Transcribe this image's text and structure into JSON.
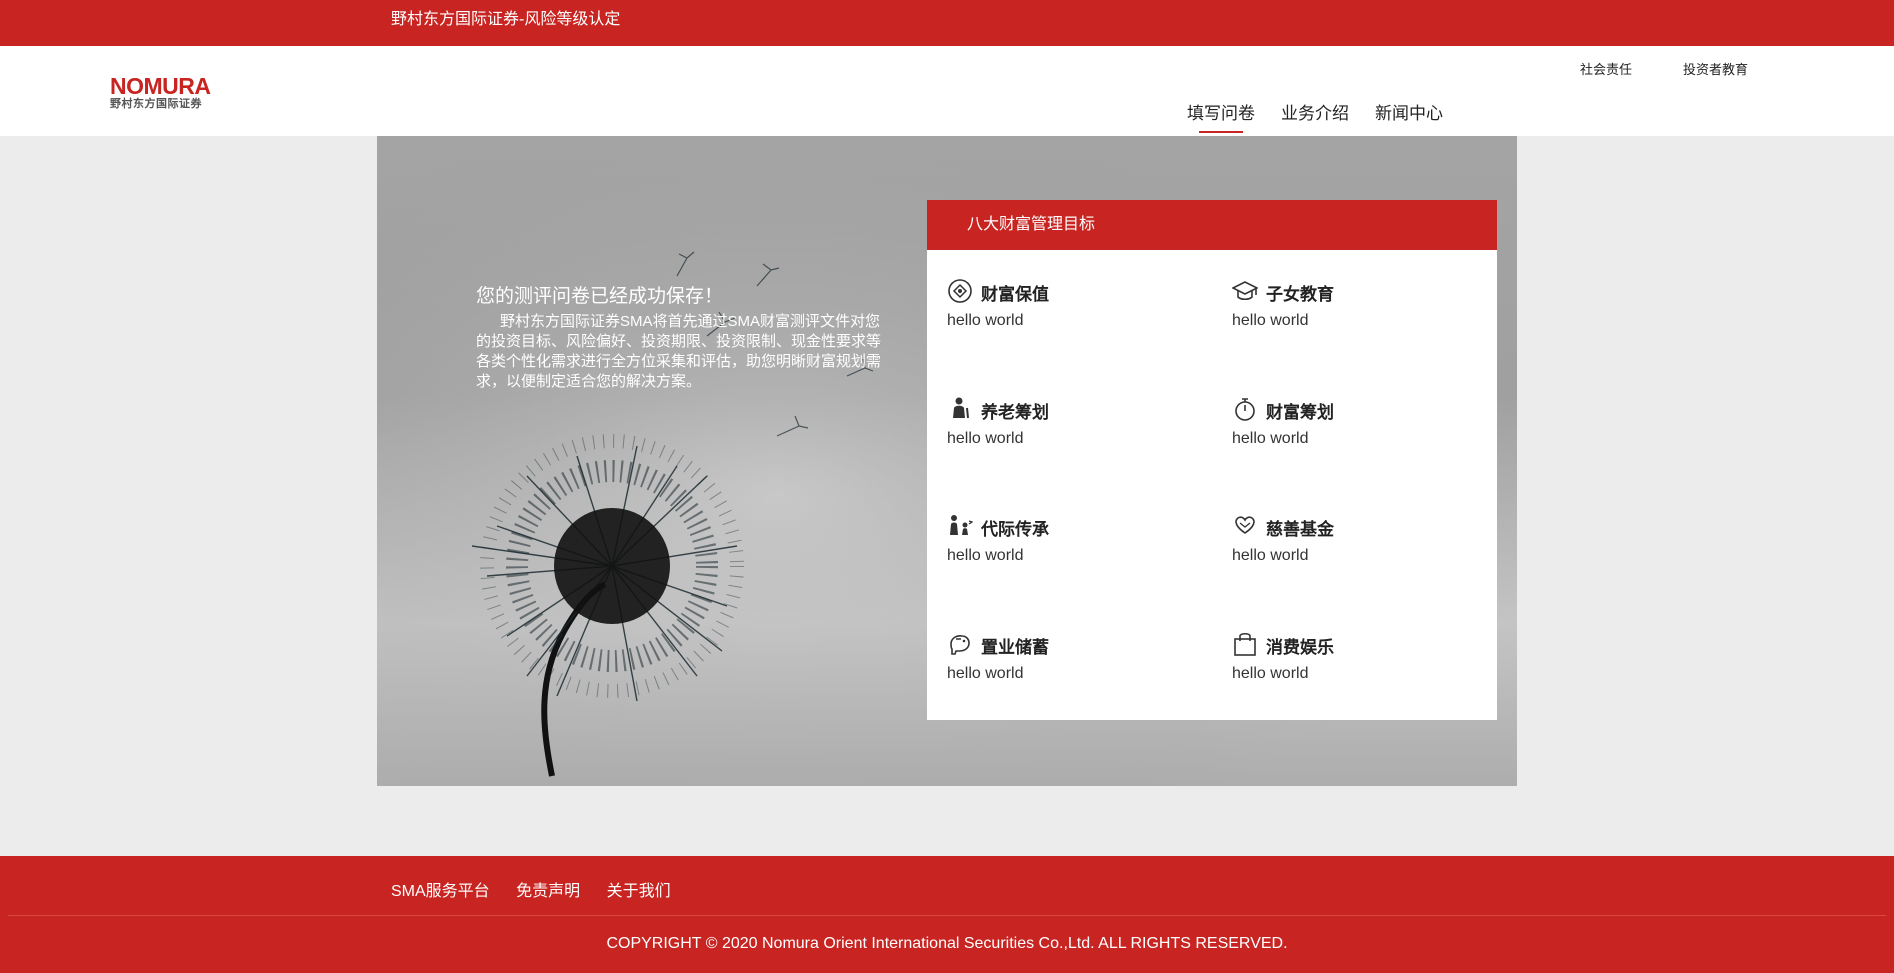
{
  "topbar": {
    "title": "野村东方国际证券-风险等级认定"
  },
  "header": {
    "logo_en": "NOMURA",
    "logo_cn": "野村东方国际证券",
    "util_links": [
      "社会责任",
      "投资者教育"
    ],
    "nav": [
      {
        "label": "填写问卷",
        "active": true
      },
      {
        "label": "业务介绍",
        "active": false
      },
      {
        "label": "新闻中心",
        "active": false
      }
    ]
  },
  "hero": {
    "heading": "您的测评问卷已经成功保存！",
    "body": "野村东方国际证券SMA将首先通过SMA财富测评文件对您的投资目标、风险偏好、投资期限、投资限制、现金性要求等各类个性化需求进行全方位采集和评估，助您明晰财富规划需求，以便制定适合您的解决方案。"
  },
  "card": {
    "title": "八大财富管理目标",
    "goals": [
      {
        "title": "财富保值",
        "desc": "hello world",
        "icon": "coin-target-icon"
      },
      {
        "title": "子女教育",
        "desc": "hello world",
        "icon": "graduation-cap-icon"
      },
      {
        "title": "养老筹划",
        "desc": "hello world",
        "icon": "elderly-person-icon"
      },
      {
        "title": "财富筹划",
        "desc": "hello world",
        "icon": "stopwatch-icon"
      },
      {
        "title": "代际传承",
        "desc": "hello world",
        "icon": "family-icon"
      },
      {
        "title": "慈善基金",
        "desc": "hello world",
        "icon": "heart-hands-icon"
      },
      {
        "title": "置业储蓄",
        "desc": "hello world",
        "icon": "piggy-bank-icon"
      },
      {
        "title": "消费娱乐",
        "desc": "hello world",
        "icon": "shopping-bag-icon"
      }
    ]
  },
  "footer": {
    "links": [
      "SMA服务平台",
      "免责声明",
      "关于我们"
    ],
    "copyright": "COPYRIGHT © 2020 Nomura Orient International Securities Co.,Ltd. ALL RIGHTS RESERVED."
  },
  "colors": {
    "brand_red": "#c82421",
    "page_bg": "#ececec"
  }
}
